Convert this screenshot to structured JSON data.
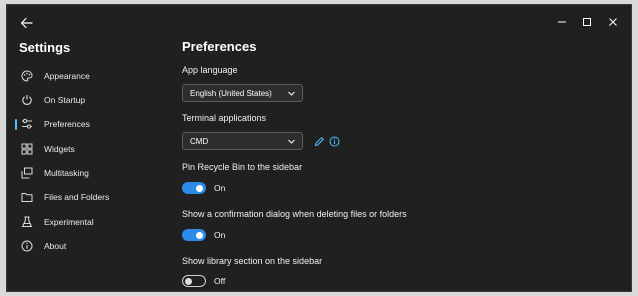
{
  "window": {
    "title": "Settings",
    "back_icon": "arrow-left-icon",
    "caption_buttons": [
      "minimize-icon",
      "maximize-icon",
      "close-icon"
    ]
  },
  "sidebar": {
    "items": [
      {
        "label": "Appearance",
        "icon": "palette-icon"
      },
      {
        "label": "On Startup",
        "icon": "power-icon"
      },
      {
        "label": "Preferences",
        "icon": "sliders-icon",
        "active": true
      },
      {
        "label": "Widgets",
        "icon": "widgets-icon"
      },
      {
        "label": "Multitasking",
        "icon": "multitask-icon"
      },
      {
        "label": "Files and Folders",
        "icon": "folder-icon"
      },
      {
        "label": "Experimental",
        "icon": "flask-icon"
      },
      {
        "label": "About",
        "icon": "info-icon"
      }
    ]
  },
  "main": {
    "title": "Preferences",
    "app_language": {
      "label": "App language",
      "value": "English (United States)"
    },
    "terminal": {
      "label": "Terminal applications",
      "value": "CMD"
    },
    "pin_recycle": {
      "label": "Pin Recycle Bin to the sidebar",
      "state": "On",
      "on": true
    },
    "confirm_delete": {
      "label": "Show a confirmation dialog when deleting files or folders",
      "state": "On",
      "on": true
    },
    "library_section": {
      "label": "Show library section on the sidebar",
      "state": "Off",
      "on": false
    }
  },
  "colors": {
    "accent": "#2d8ae8",
    "info": "#4cc2ff",
    "background": "#202020"
  }
}
